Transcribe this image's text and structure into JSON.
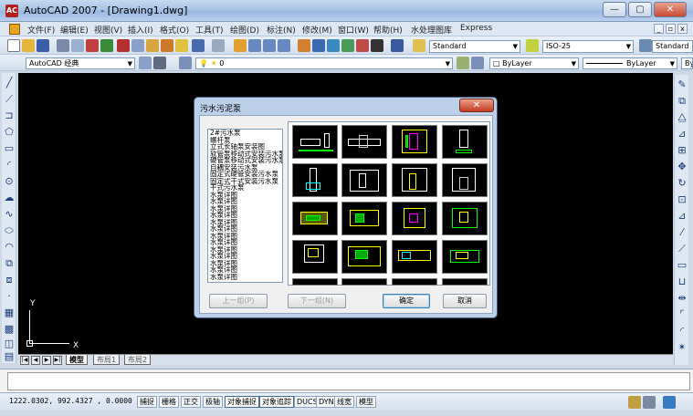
{
  "window": {
    "title": "AutoCAD 2007 - [Drawing1.dwg]",
    "logo_text": "AC",
    "minimize": "—",
    "maximize": "▢",
    "close": "✕"
  },
  "menu": {
    "items": [
      "文件(F)",
      "编辑(E)",
      "视图(V)",
      "插入(I)",
      "格式(O)",
      "工具(T)",
      "绘图(D)",
      "标注(N)",
      "修改(M)",
      "窗口(W)",
      "帮助(H)",
      "水处理图库",
      "Express"
    ],
    "mdi_min": "_",
    "mdi_restore": "▫",
    "mdi_close": "x"
  },
  "toolbar": {
    "text_style": "Standard",
    "dim_style": "ISO-25",
    "table_style": "Standard",
    "workspace": "AutoCAD 经典",
    "layer": "0",
    "color": "ByLayer",
    "linetype": "ByLayer",
    "lineweight": "ByLa"
  },
  "dialog": {
    "title": "污水污泥泵",
    "close": "✕",
    "list_items": [
      "2#污水泵",
      "螺杆泵",
      "立式长轴泵安装图",
      "软管泵移动式安装污水泵",
      "硬管泵移动式安装污水泵",
      "自耦安装污水泵",
      "固定式硬管安装污水泵",
      "固定式干式安装污水泵",
      "干式污水泵",
      "水泵详图",
      "水泵详图",
      "水泵详图",
      "水泵详图",
      "水泵详图",
      "水泵详图",
      "水泵详图",
      "水泵详图",
      "水泵详图",
      "水泵详图",
      "水泵详图",
      "水泵详图",
      "水泵详图"
    ],
    "prev_button": "上一组(P)",
    "next_button": "下一组(N)",
    "ok_button": "确定",
    "cancel_button": "取消"
  },
  "canvas": {
    "ucs_x": "X",
    "ucs_y": "Y"
  },
  "layout_tabs": [
    "模型",
    "布局1",
    "布局2"
  ],
  "status": {
    "coordinates": "1222.0302, 992.4327 , 0.0000",
    "buttons": [
      "捕捉",
      "栅格",
      "正交",
      "极轴",
      "对象捕捉",
      "对象追踪",
      "DUCS",
      "DYN",
      "线宽",
      "模型"
    ]
  }
}
